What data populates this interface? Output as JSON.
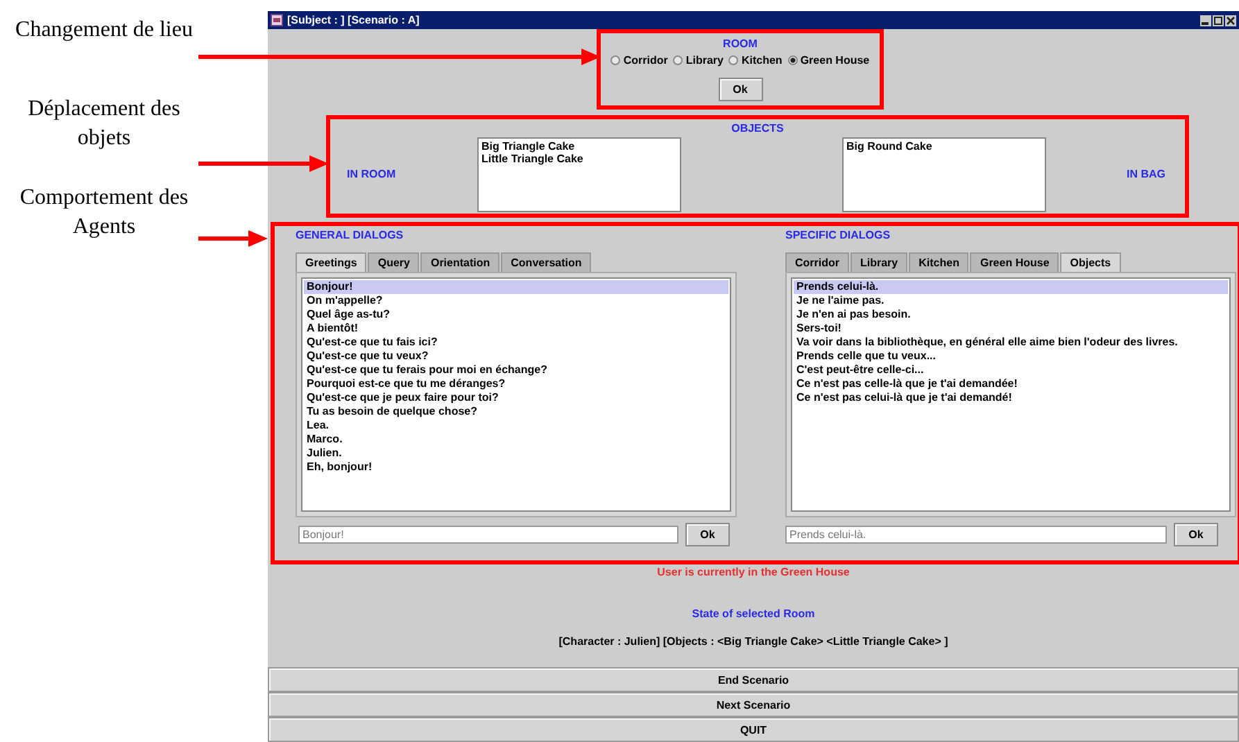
{
  "annotations": [
    {
      "text": "Changement de lieu"
    },
    {
      "text": "Déplacement des objets"
    },
    {
      "text": "Comportement des Agents"
    }
  ],
  "window": {
    "title": "[Subject : ] [Scenario : A]"
  },
  "room": {
    "heading": "ROOM",
    "options": [
      {
        "label": "Corridor",
        "selected": false
      },
      {
        "label": "Library",
        "selected": false
      },
      {
        "label": "Kitchen",
        "selected": false
      },
      {
        "label": "Green House",
        "selected": true
      }
    ],
    "ok_button": "Ok"
  },
  "objects": {
    "heading": "OBJECTS",
    "in_room_label": "IN ROOM",
    "in_room_items": [
      "Big Triangle Cake",
      "Little Triangle Cake"
    ],
    "in_bag_items": [
      "Big Round Cake"
    ],
    "in_bag_label": "IN BAG"
  },
  "general_dialogs": {
    "heading": "GENERAL DIALOGS",
    "tabs": [
      {
        "label": "Greetings",
        "selected": true
      },
      {
        "label": "Query",
        "selected": false
      },
      {
        "label": "Orientation",
        "selected": false
      },
      {
        "label": "Conversation",
        "selected": false
      }
    ],
    "lines": [
      {
        "text": "Bonjour!",
        "selected": true
      },
      {
        "text": "On m'appelle?",
        "selected": false
      },
      {
        "text": "Quel âge as-tu?",
        "selected": false
      },
      {
        "text": "A bientôt!",
        "selected": false
      },
      {
        "text": "Qu'est-ce que tu fais ici?",
        "selected": false
      },
      {
        "text": "Qu'est-ce que tu veux?",
        "selected": false
      },
      {
        "text": "Qu'est-ce que tu ferais pour moi en échange?",
        "selected": false
      },
      {
        "text": "Pourquoi est-ce que tu me déranges?",
        "selected": false
      },
      {
        "text": "Qu'est-ce que je peux faire pour toi?",
        "selected": false
      },
      {
        "text": "Tu as besoin de quelque chose?",
        "selected": false
      },
      {
        "text": "Lea.",
        "selected": false
      },
      {
        "text": "Marco.",
        "selected": false
      },
      {
        "text": "Julien.",
        "selected": false
      },
      {
        "text": "Eh, bonjour!",
        "selected": false
      }
    ],
    "input_value": "Bonjour!",
    "ok_button": "Ok"
  },
  "specific_dialogs": {
    "heading": "SPECIFIC DIALOGS",
    "tabs": [
      {
        "label": "Corridor",
        "selected": false
      },
      {
        "label": "Library",
        "selected": false
      },
      {
        "label": "Kitchen",
        "selected": false
      },
      {
        "label": "Green House",
        "selected": false
      },
      {
        "label": "Objects",
        "selected": true
      }
    ],
    "lines": [
      {
        "text": "Prends celui-là.",
        "selected": true
      },
      {
        "text": "Je ne l'aime pas.",
        "selected": false
      },
      {
        "text": "Je n'en ai pas besoin.",
        "selected": false
      },
      {
        "text": "Sers-toi!",
        "selected": false
      },
      {
        "text": "Va voir dans la bibliothèque, en général elle aime bien l'odeur des livres.",
        "selected": false
      },
      {
        "text": "Prends celle que tu veux...",
        "selected": false
      },
      {
        "text": "C'est peut-être celle-ci...",
        "selected": false
      },
      {
        "text": "Ce n'est pas celle-là que je t'ai demandée!",
        "selected": false
      },
      {
        "text": "Ce n'est pas celui-là que je t'ai demandé!",
        "selected": false
      }
    ],
    "input_value": "Prends celui-là.",
    "ok_button": "Ok"
  },
  "status": "User is currently in the Green House",
  "room_state": {
    "heading": "State of selected Room",
    "text": "[Character : Julien] [Objects : <Big Triangle Cake> <Little Triangle Cake> ]"
  },
  "buttons": [
    "End Scenario",
    "Next Scenario",
    "QUIT"
  ]
}
